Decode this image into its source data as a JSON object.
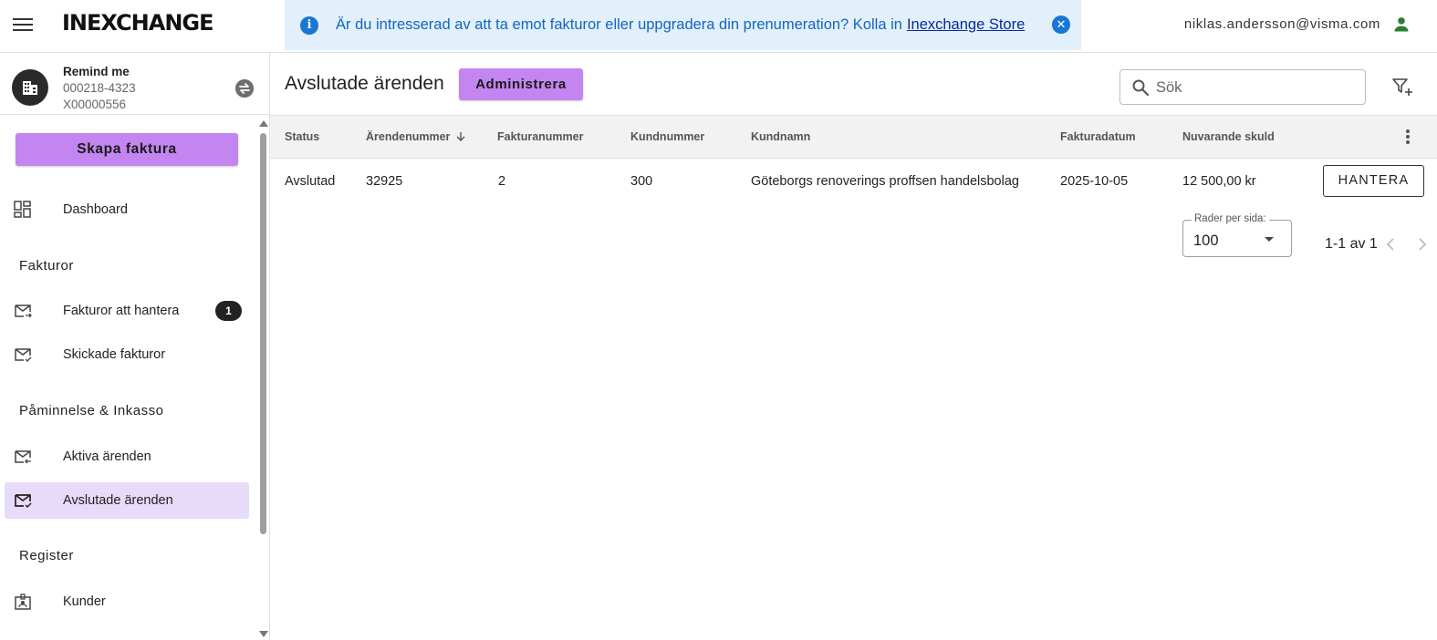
{
  "header": {
    "logo": "INEXCHANGE",
    "banner_message": "Är du intresserad av att ta emot fakturor eller uppgradera din prenumeration? Kolla in",
    "banner_link": "Inexchange Store",
    "user_email": "niklas.andersson@visma.com"
  },
  "sidebar": {
    "org_name": "Remind me",
    "org_id": "000218-4323",
    "org_code": "X00000556",
    "create_button": "Skapa faktura",
    "dashboard": "Dashboard",
    "section_fakturor": "Fakturor",
    "fakturor_att_hantera": "Fakturor att hantera",
    "fakturor_att_hantera_count": "1",
    "skickade_fakturor": "Skickade fakturor",
    "section_paminnelse": "Påminnelse & Inkasso",
    "aktiva_arenden": "Aktiva ärenden",
    "avslutade_arenden": "Avslutade ärenden",
    "section_register": "Register",
    "kunder": "Kunder"
  },
  "main": {
    "title": "Avslutade ärenden",
    "admin_button": "Administrera",
    "search_placeholder": "Sök",
    "columns": {
      "status": "Status",
      "arendenummer": "Ärendenummer",
      "fakturanummer": "Fakturanummer",
      "kundnummer": "Kundnummer",
      "kundnamn": "Kundnamn",
      "fakturadatum": "Fakturadatum",
      "nuvarande_skuld": "Nuvarande skuld"
    },
    "rows": [
      {
        "status": "Avslutad",
        "arendenummer": "32925",
        "fakturanummer": "2",
        "kundnummer": "300",
        "kundnamn": "Göteborgs renoverings proffsen handelsbolag",
        "fakturadatum": "2025-10-05",
        "nuvarande_skuld": "12 500,00 kr",
        "action": "HANTERA"
      }
    ],
    "pagination": {
      "rows_label": "Rader per sida:",
      "rows_value": "100",
      "range": "1-1 av 1"
    }
  },
  "colors": {
    "accent": "#c385f0",
    "active_nav": "#e8daf9",
    "banner_bg": "#e1f0fb",
    "user_icon": "#2e7d32"
  },
  "icons": [
    "menu-icon",
    "info-icon",
    "close-icon",
    "person-icon",
    "building-icon",
    "swap-icon",
    "dashboard-icon",
    "mail-icon",
    "mail-check-icon",
    "search-icon",
    "filter-add-icon",
    "sort-down-icon",
    "more-vert-icon",
    "chevron-left-icon",
    "chevron-right-icon",
    "badge-icon"
  ]
}
